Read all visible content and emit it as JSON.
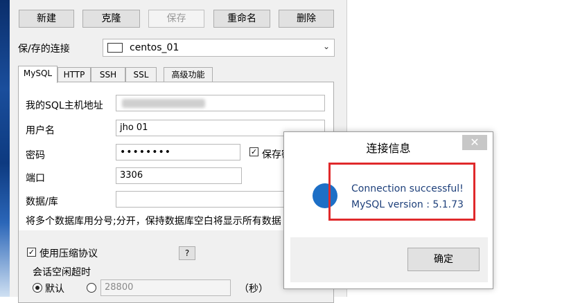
{
  "toolbar": {
    "new_label": "新建",
    "clone_label": "克隆",
    "save_label": "保存",
    "rename_label": "重命名",
    "delete_label": "删除"
  },
  "saved_connection": {
    "label": "保/存的连接",
    "selected": "centos_01"
  },
  "tabs": [
    {
      "label": "MySQL",
      "active": true
    },
    {
      "label": "HTTP"
    },
    {
      "label": "SSH"
    },
    {
      "label": "SSL"
    },
    {
      "label": "高级功能"
    }
  ],
  "form": {
    "host_label": "我的SQL主机地址",
    "user_label": "用户名",
    "user_value": "jho    01",
    "password_label": "密码",
    "password_value": "••••••••",
    "save_password_label": "保存密",
    "port_label": "端口",
    "port_value": "3306",
    "database_label": "数据/库",
    "database_hint": "将多个数据库用分号;分开，保持数据库空白将显示所有数据",
    "compression_label": "使用压缩协议",
    "help_label": "?",
    "session_timeout_label": "会话空闲超时",
    "default_label": "默认",
    "timeout_value": "28800",
    "seconds_label": "（秒）"
  },
  "dialog": {
    "title": "连接信息",
    "close_icon": "close-icon",
    "line1": "Connection successful!",
    "line2": "MySQL version : 5.1.73",
    "ok_label": "确定"
  },
  "colors": {
    "highlight_red": "#e0292b",
    "info_blue": "#1d6fc6"
  }
}
